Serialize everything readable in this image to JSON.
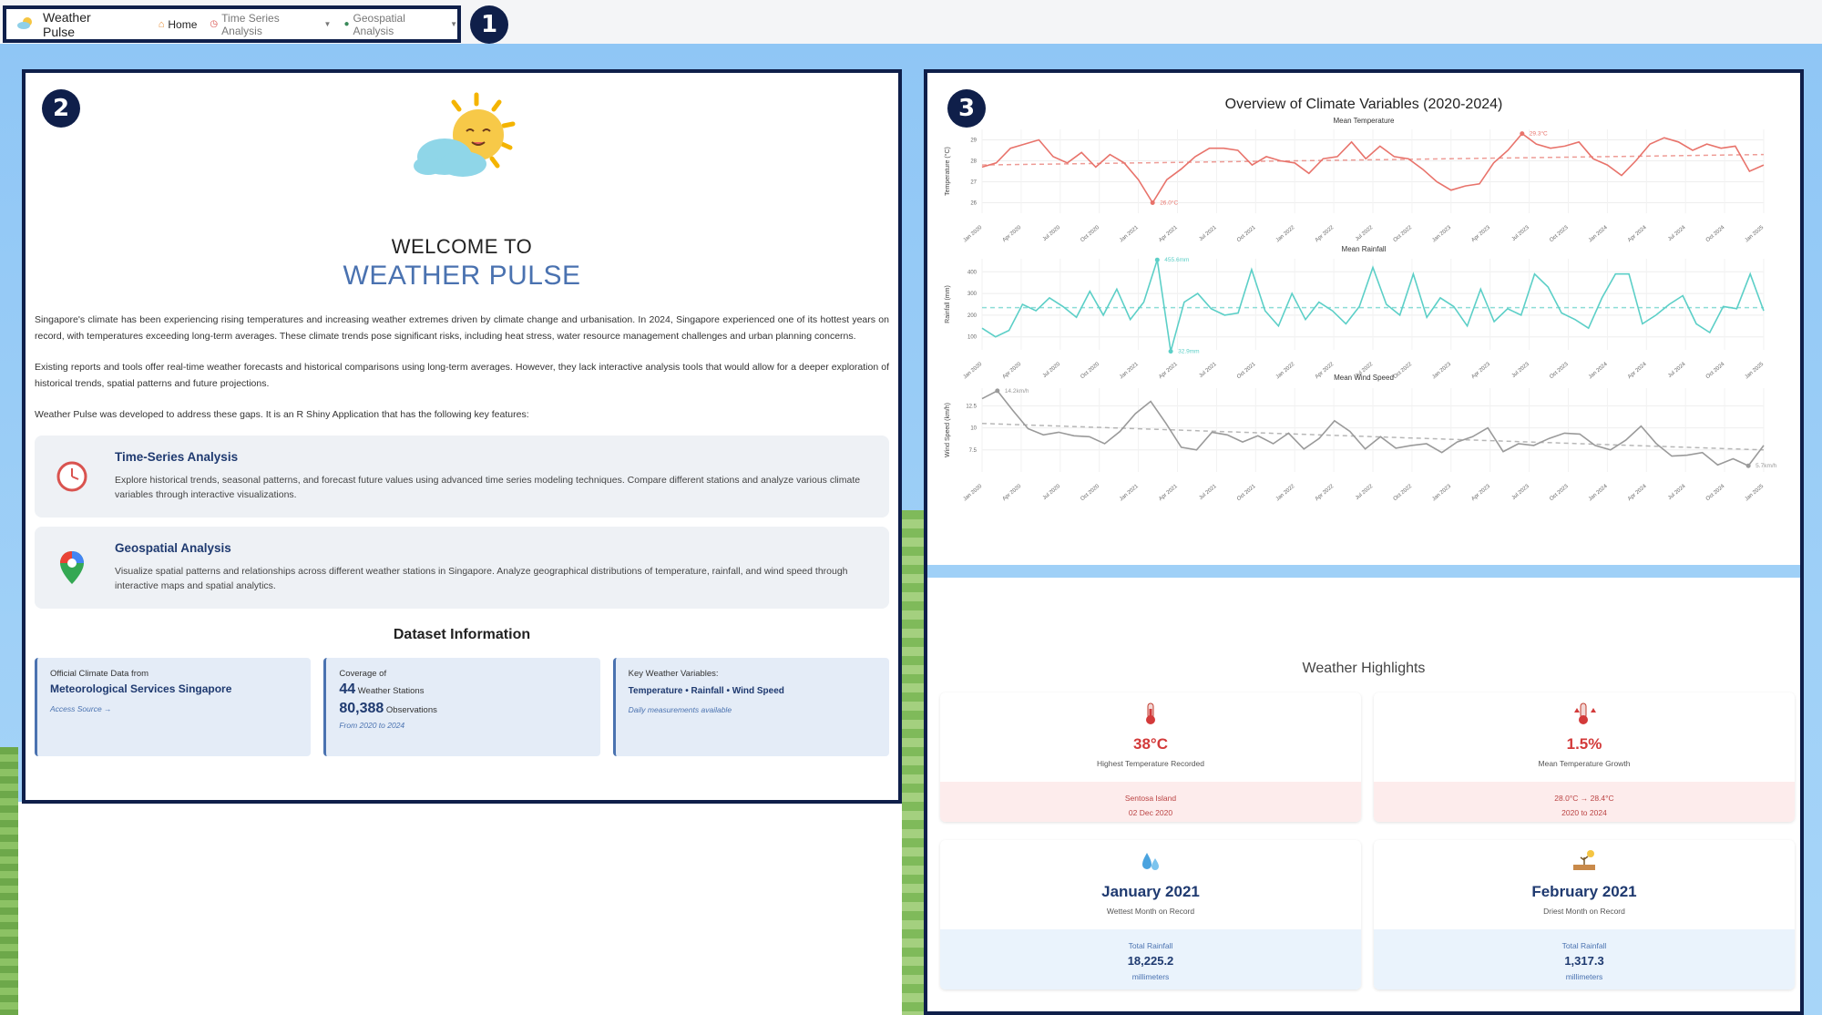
{
  "nav": {
    "brand": "Weather Pulse",
    "items": [
      {
        "label": "Home",
        "icon": "house-icon",
        "active": true
      },
      {
        "label": "Time Series Analysis",
        "icon": "clock-icon",
        "dropdown": true
      },
      {
        "label": "Geospatial Analysis",
        "icon": "pin-icon",
        "dropdown": true
      }
    ]
  },
  "badges": [
    "1",
    "2",
    "3"
  ],
  "home": {
    "welcome_to": "WELCOME TO",
    "app_name": "WEATHER PULSE",
    "intro": [
      "Singapore's climate has been experiencing rising temperatures and increasing weather extremes driven by climate change and urbanisation. In 2024, Singapore experienced one of its hottest years on record, with temperatures exceeding long-term averages. These climate trends pose significant risks, including heat stress, water resource management challenges and urban planning concerns.",
      "Existing reports and tools offer real-time weather forecasts and historical comparisons using long-term averages. However, they lack interactive analysis tools that would allow for a deeper exploration of historical trends, spatial patterns and future projections.",
      "Weather Pulse was developed to address these gaps. It is an R Shiny Application that has the following key features:"
    ],
    "features": [
      {
        "title": "Time-Series Analysis",
        "desc": "Explore historical trends, seasonal patterns, and forecast future values using advanced time series modeling techniques. Compare different stations and analyze various climate variables through interactive visualizations.",
        "icon": "clock-icon"
      },
      {
        "title": "Geospatial Analysis",
        "desc": "Visualize spatial patterns and relationships across different weather stations in Singapore. Analyze geographical distributions of temperature, rainfall, and wind speed through interactive maps and spatial analytics.",
        "icon": "map-pin-icon"
      }
    ],
    "dataset": {
      "title": "Dataset Information",
      "source_label": "Official Climate Data from",
      "source_name": "Meteorological Services Singapore",
      "source_link": "Access Source →",
      "coverage_label": "Coverage of",
      "stations_num": "44",
      "stations_text": "Weather Stations",
      "obs_num": "80,388",
      "obs_text": "Observations",
      "coverage_period": "From 2020 to 2024",
      "vars_label": "Key Weather Variables:",
      "vars": "Temperature • Rainfall • Wind Speed",
      "vars_note": "Daily measurements available"
    }
  },
  "overview": {
    "title": "Overview of Climate Variables (2020-2024)"
  },
  "chart_data": [
    {
      "type": "line",
      "title": "Mean Temperature",
      "ylabel": "Temperature (°C)",
      "ylim": [
        25.5,
        29.5
      ],
      "yticks": [
        26,
        27,
        28,
        29
      ],
      "x_ticks": [
        "Jan 2020",
        "Apr 2020",
        "Jul 2020",
        "Oct 2020",
        "Jan 2021",
        "Apr 2021",
        "Jul 2021",
        "Oct 2021",
        "Jan 2022",
        "Apr 2022",
        "Jul 2022",
        "Oct 2022",
        "Jan 2023",
        "Apr 2023",
        "Jul 2023",
        "Oct 2023",
        "Jan 2024",
        "Apr 2024",
        "Jul 2024",
        "Oct 2024",
        "Jan 2025"
      ],
      "color": "#e8736b",
      "values": [
        27.7,
        27.9,
        28.6,
        28.8,
        29.0,
        28.2,
        27.9,
        28.4,
        27.7,
        28.3,
        27.9,
        27.1,
        26.0,
        27.1,
        27.6,
        28.2,
        28.6,
        28.6,
        28.5,
        27.8,
        28.2,
        28.0,
        27.9,
        27.4,
        28.1,
        28.2,
        28.9,
        28.1,
        28.7,
        28.2,
        28.1,
        27.6,
        27.0,
        26.6,
        26.8,
        26.9,
        27.9,
        28.5,
        29.3,
        28.8,
        28.6,
        28.7,
        28.9,
        28.1,
        27.8,
        27.3,
        28.0,
        28.8,
        29.1,
        28.9,
        28.5,
        28.8,
        28.6,
        28.7,
        27.5,
        27.8
      ],
      "trend": [
        27.8,
        28.3
      ],
      "annotations": [
        {
          "label": "29.3°C",
          "index": 38
        },
        {
          "label": "26.0°C",
          "index": 12
        }
      ]
    },
    {
      "type": "line",
      "title": "Mean Rainfall",
      "ylabel": "Rainfall (mm)",
      "ylim": [
        40,
        460
      ],
      "yticks": [
        100,
        200,
        300,
        400
      ],
      "x_ticks": [
        "Jan 2020",
        "Apr 2020",
        "Jul 2020",
        "Oct 2020",
        "Jan 2021",
        "Apr 2021",
        "Jul 2021",
        "Oct 2021",
        "Jan 2022",
        "Apr 2022",
        "Jul 2022",
        "Oct 2022",
        "Jan 2023",
        "Apr 2023",
        "Jul 2023",
        "Oct 2023",
        "Jan 2024",
        "Apr 2024",
        "Jul 2024",
        "Oct 2024",
        "Jan 2025"
      ],
      "color": "#5ccfc7",
      "values": [
        140,
        100,
        130,
        250,
        220,
        280,
        240,
        190,
        310,
        200,
        320,
        180,
        260,
        455,
        33,
        260,
        300,
        230,
        200,
        210,
        410,
        220,
        150,
        300,
        180,
        260,
        220,
        160,
        240,
        420,
        250,
        200,
        390,
        190,
        280,
        240,
        150,
        320,
        170,
        230,
        200,
        390,
        330,
        210,
        180,
        140,
        280,
        390,
        390,
        160,
        200,
        250,
        290,
        160,
        120,
        240,
        230,
        390,
        220
      ],
      "trend": [
        235,
        235
      ],
      "annotations": [
        {
          "label": "455.6mm",
          "index": 13
        },
        {
          "label": "32.9mm",
          "index": 14
        }
      ]
    },
    {
      "type": "line",
      "title": "Mean Wind Speed",
      "ylabel": "Wind Speed (km/h)",
      "ylim": [
        5,
        14.5
      ],
      "yticks": [
        7.5,
        10,
        12.5
      ],
      "x_ticks": [
        "Jan 2020",
        "Apr 2020",
        "Jul 2020",
        "Oct 2020",
        "Jan 2021",
        "Apr 2021",
        "Jul 2021",
        "Oct 2021",
        "Jan 2022",
        "Apr 2022",
        "Jul 2022",
        "Oct 2022",
        "Jan 2023",
        "Apr 2023",
        "Jul 2023",
        "Oct 2023",
        "Jan 2024",
        "Apr 2024",
        "Jul 2024",
        "Oct 2024",
        "Jan 2025"
      ],
      "color": "#9a9a9a",
      "values": [
        13.3,
        14.2,
        12.0,
        9.9,
        9.2,
        9.5,
        9.1,
        9.0,
        8.2,
        9.6,
        11.6,
        13.0,
        10.5,
        7.8,
        7.5,
        9.5,
        9.2,
        8.4,
        9.1,
        8.2,
        9.4,
        7.6,
        8.8,
        10.8,
        9.6,
        7.6,
        9.0,
        7.7,
        8.0,
        8.2,
        7.2,
        8.4,
        9.0,
        10.0,
        7.3,
        8.2,
        8.0,
        8.8,
        9.4,
        9.3,
        8.0,
        7.5,
        8.6,
        10.2,
        8.2,
        6.8,
        6.9,
        7.2,
        5.8,
        6.5,
        5.7,
        8.0
      ],
      "trend": [
        10.5,
        7.5
      ],
      "annotations": [
        {
          "label": "14.2km/h",
          "index": 1
        },
        {
          "label": "5.7km/h",
          "index": 50
        }
      ]
    }
  ],
  "highlights": {
    "title": "Weather Highlights",
    "cards": [
      {
        "value": "38°C",
        "label": "Highest Temperature Recorded",
        "foot1": "Sentosa Island",
        "foot2": "02 Dec 2020",
        "icon": "thermometer-icon"
      },
      {
        "value": "1.5%",
        "label": "Mean Temperature Growth",
        "foot1": "28.0°C → 28.4°C",
        "foot2": "2020 to 2024",
        "icon": "temperature-up-icon"
      },
      {
        "value": "January 2021",
        "label": "Wettest Month on Record",
        "foot_label": "Total Rainfall",
        "foot_value": "18,225.2",
        "foot_unit": "millimeters",
        "icon": "droplets-icon"
      },
      {
        "value": "February 2021",
        "label": "Driest Month on Record",
        "foot_label": "Total Rainfall",
        "foot_value": "1,317.3",
        "foot_unit": "millimeters",
        "icon": "dry-soil-icon"
      }
    ]
  }
}
